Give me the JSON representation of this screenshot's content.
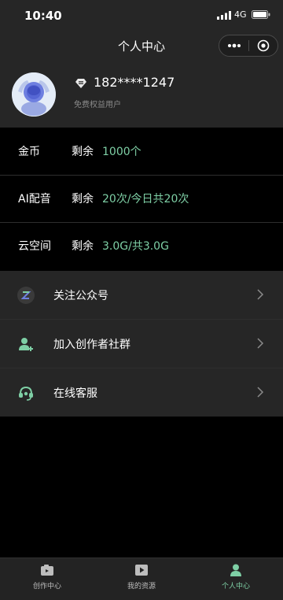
{
  "status_bar": {
    "time": "10:40",
    "network": "4G"
  },
  "header": {
    "title": "个人中心"
  },
  "profile": {
    "phone": "182****1247",
    "subtitle": "免费权益用户"
  },
  "quotas": [
    {
      "label": "金币",
      "remaining_label": "剩余",
      "value": "1000个"
    },
    {
      "label": "AI配音",
      "remaining_label": "剩余",
      "value": "20次/今日共20次"
    },
    {
      "label": "云空间",
      "remaining_label": "剩余",
      "value": "3.0G/共3.0G"
    }
  ],
  "menu": [
    {
      "label": "关注公众号",
      "icon": "official-account-icon"
    },
    {
      "label": "加入创作者社群",
      "icon": "add-user-icon"
    },
    {
      "label": "在线客服",
      "icon": "headset-icon"
    }
  ],
  "tabs": [
    {
      "label": "创作中心",
      "icon": "camera-icon",
      "active": false
    },
    {
      "label": "我的资源",
      "icon": "play-icon",
      "active": false
    },
    {
      "label": "个人中心",
      "icon": "person-icon",
      "active": true
    }
  ],
  "colors": {
    "accent": "#7ecfa5",
    "panel": "#262626",
    "background": "#000000"
  }
}
